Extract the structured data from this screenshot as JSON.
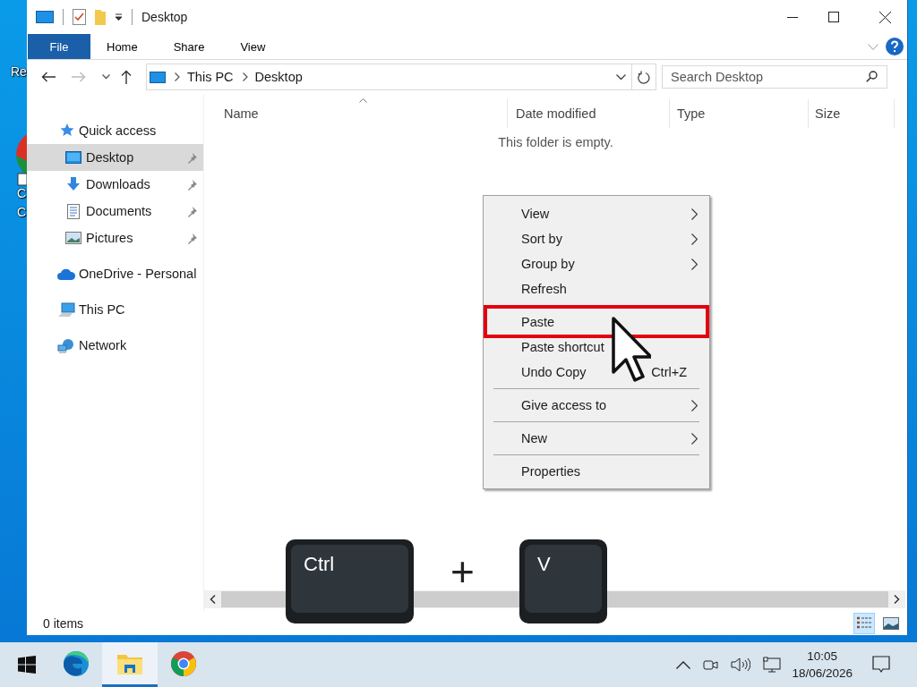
{
  "desktop": {
    "labels": [
      "Re",
      "C",
      "C"
    ]
  },
  "window": {
    "title": "Desktop"
  },
  "ribbon": {
    "tabs": [
      {
        "label": "File",
        "kind": "file"
      },
      {
        "label": "Home",
        "kind": "tab"
      },
      {
        "label": "Share",
        "kind": "tab"
      },
      {
        "label": "View",
        "kind": "tab"
      }
    ]
  },
  "address": {
    "path": [
      "This PC",
      "Desktop"
    ],
    "search_placeholder": "Search Desktop"
  },
  "navigation": [
    {
      "label": "Quick access",
      "selected": false,
      "children": [
        {
          "label": "Desktop",
          "selected": true,
          "pinned": true
        },
        {
          "label": "Downloads",
          "selected": false,
          "pinned": true
        },
        {
          "label": "Documents",
          "selected": false,
          "pinned": true
        },
        {
          "label": "Pictures",
          "selected": false,
          "pinned": true
        }
      ]
    },
    {
      "label": "OneDrive - Personal",
      "selected": false
    },
    {
      "label": "This PC",
      "selected": false
    },
    {
      "label": "Network",
      "selected": false
    }
  ],
  "columns": [
    "Name",
    "Date modified",
    "Type",
    "Size"
  ],
  "empty_message": "This folder is empty.",
  "context_menu": [
    {
      "kind": "item",
      "label": "View",
      "submenu": true,
      "highlighted": false
    },
    {
      "kind": "item",
      "label": "Sort by",
      "submenu": true,
      "highlighted": false
    },
    {
      "kind": "item",
      "label": "Group by",
      "submenu": true,
      "highlighted": false
    },
    {
      "kind": "item",
      "label": "Refresh",
      "submenu": false,
      "highlighted": false
    },
    {
      "kind": "separator"
    },
    {
      "kind": "item",
      "label": "Paste",
      "submenu": false,
      "highlighted": true
    },
    {
      "kind": "item",
      "label": "Paste shortcut",
      "submenu": false,
      "highlighted": false
    },
    {
      "kind": "item",
      "label": "Undo Copy",
      "submenu": false,
      "shortcut": "Ctrl+Z",
      "highlighted": false
    },
    {
      "kind": "separator"
    },
    {
      "kind": "item",
      "label": "Give access to",
      "submenu": true,
      "highlighted": false
    },
    {
      "kind": "separator"
    },
    {
      "kind": "item",
      "label": "New",
      "submenu": true,
      "highlighted": false
    },
    {
      "kind": "separator"
    },
    {
      "kind": "item",
      "label": "Properties",
      "submenu": false,
      "highlighted": false
    }
  ],
  "key_combo": {
    "keys": [
      "Ctrl",
      "V"
    ],
    "joiner": "+"
  },
  "status_bar": {
    "items": "0 items",
    "views": [
      {
        "selected": true
      },
      {
        "selected": false
      }
    ]
  },
  "taskbar": {
    "apps": [
      {
        "selected": false
      },
      {
        "selected": true
      },
      {
        "selected": false
      }
    ],
    "time": "10:05",
    "date": "18/06/2026"
  }
}
